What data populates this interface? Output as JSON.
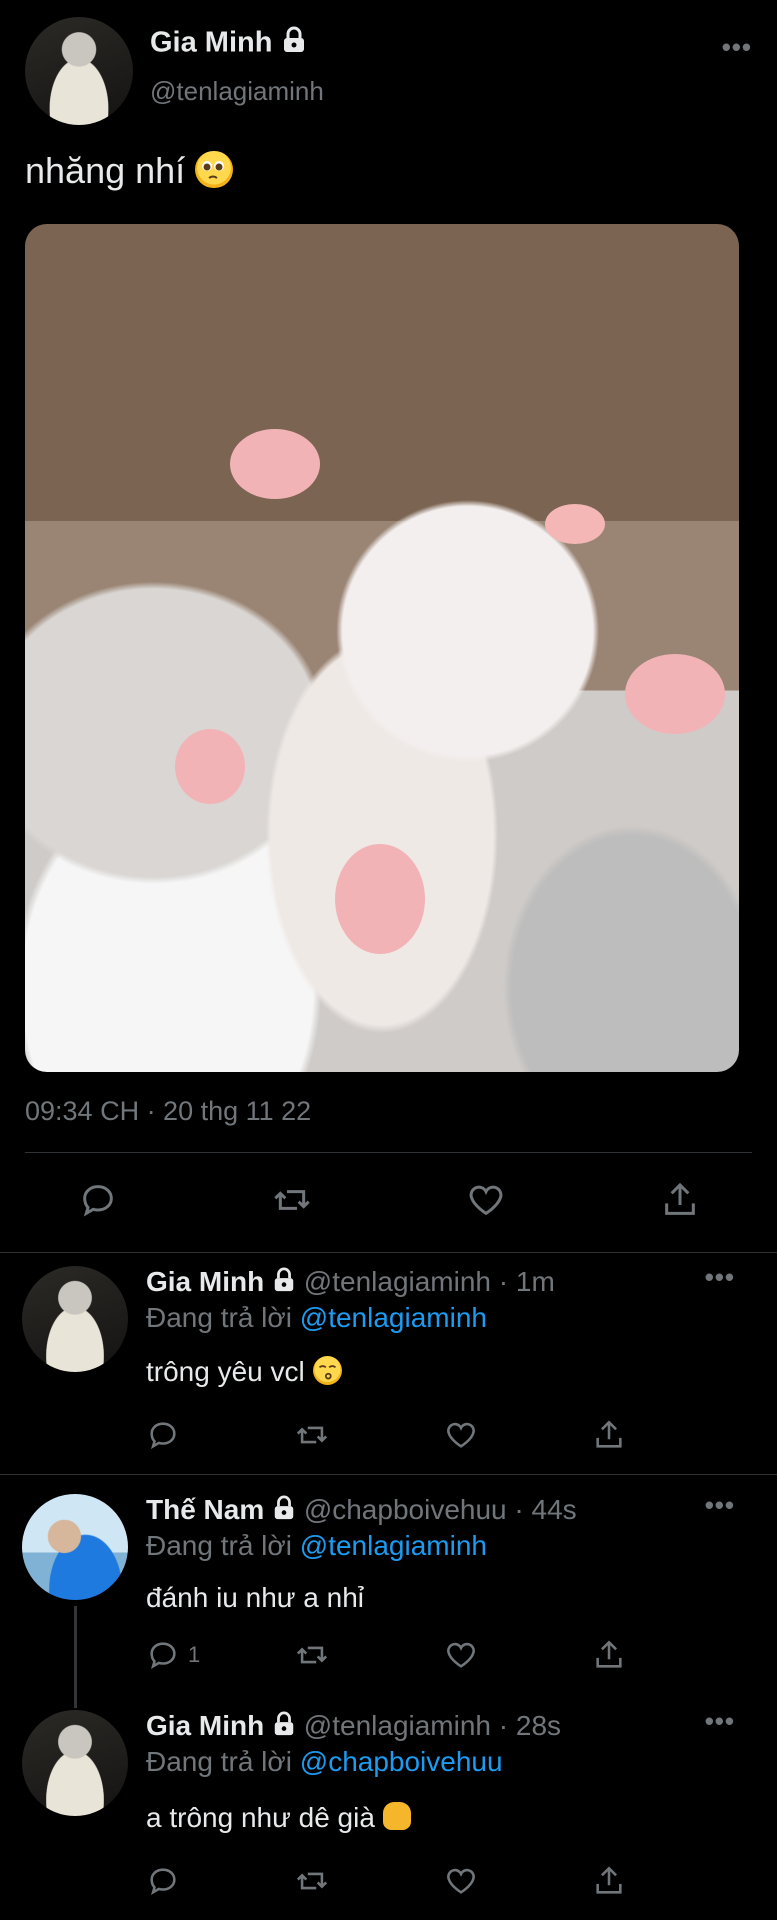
{
  "tweet": {
    "author_name": "Gia Minh",
    "author_handle": "@tenlagiaminh",
    "text": "nhăng nhí",
    "text_emoji": "pleading-face",
    "timestamp": "09:34 CH · 20 thg 11 22",
    "media_alt_description": "kittens-photo"
  },
  "replies": [
    {
      "name": "Gia Minh",
      "handle": "@tenlagiaminh",
      "age": "· 1m",
      "replying_label": "Đang trả lời",
      "replying_to": "@tenlagiaminh",
      "text": "trông yêu vcl",
      "emoji": "kissing-face",
      "reply_count": ""
    },
    {
      "name": "Thế Nam",
      "handle": "@chapboivehuu",
      "age": "· 44s",
      "replying_label": "Đang trả lời",
      "replying_to": "@tenlagiaminh",
      "text": "đánh iu như a nhỉ",
      "emoji": "",
      "reply_count": "1"
    },
    {
      "name": "Gia Minh",
      "handle": "@tenlagiaminh",
      "age": "· 28s",
      "replying_label": "Đang trả lời",
      "replying_to": "@chapboivehuu",
      "text": "a trông như dê già",
      "emoji": "thumbs-up",
      "reply_count": ""
    }
  ],
  "colors": {
    "background": "#000000",
    "text": "#e7e9ea",
    "muted": "#71767b",
    "link": "#1d9bf0",
    "divider": "#2f3336"
  }
}
